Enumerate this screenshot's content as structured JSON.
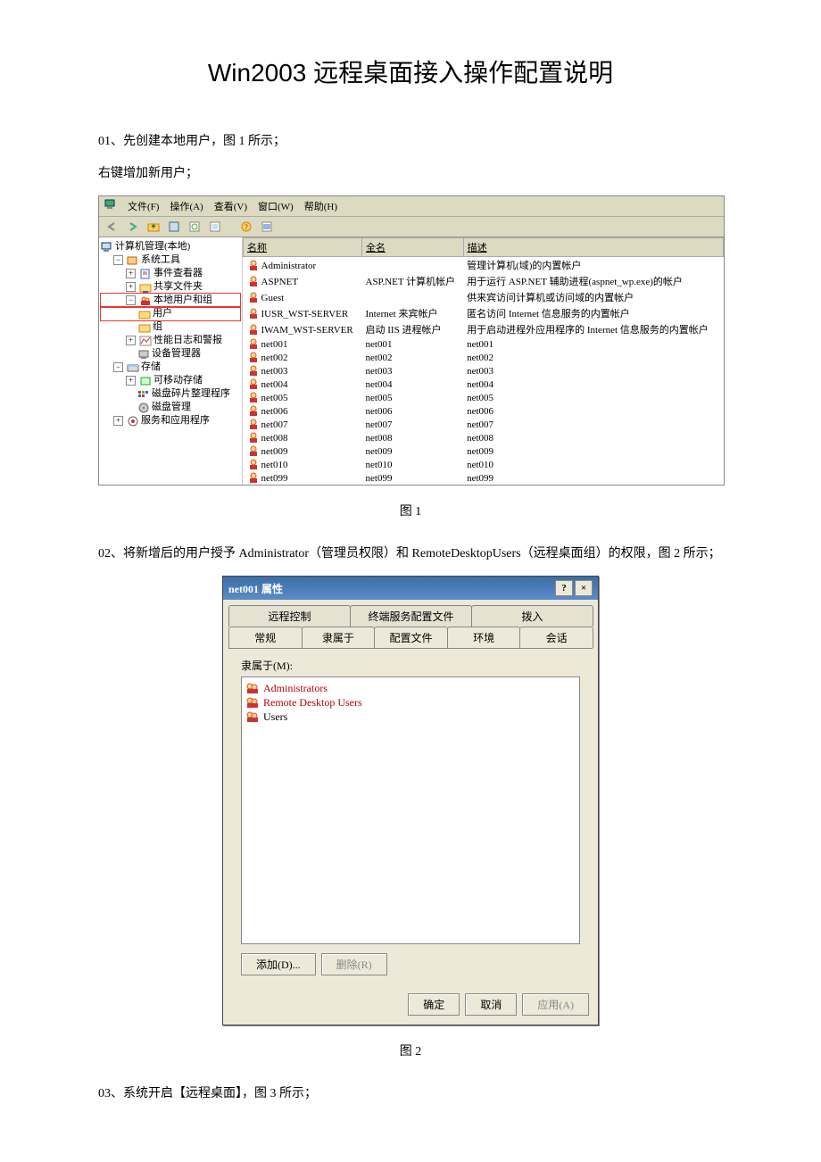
{
  "doc": {
    "title": "Win2003 远程桌面接入操作配置说明",
    "p01": "01、先创建本地用户，图 1 所示；",
    "p01a": "右键增加新用户；",
    "cap1": "图 1",
    "p02": "02、将新增后的用户授予 Administrator（管理员权限）和 RemoteDesktopUsers（远程桌面组）的权限，图 2 所示；",
    "cap2": "图 2",
    "p03": "03、系统开启【远程桌面】，图 3 所示；"
  },
  "mmc": {
    "menu": {
      "file": "文件(F)",
      "action": "操作(A)",
      "view": "查看(V)",
      "window": "窗口(W)",
      "help": "帮助(H)"
    },
    "tree": {
      "root": "计算机管理(本地)",
      "n1": "系统工具",
      "n1a": "事件查看器",
      "n1b": "共享文件夹",
      "n1c": "本地用户和组",
      "n1c1": "用户",
      "n1c2": "组",
      "n1d": "性能日志和警报",
      "n1e": "设备管理器",
      "n2": "存储",
      "n2a": "可移动存储",
      "n2b": "磁盘碎片整理程序",
      "n2c": "磁盘管理",
      "n3": "服务和应用程序"
    },
    "columns": {
      "name": "名称",
      "fullname": "全名",
      "desc": "描述"
    },
    "rows": [
      {
        "name": "Administrator",
        "full": "",
        "desc": "管理计算机(域)的内置帐户"
      },
      {
        "name": "ASPNET",
        "full": "ASP.NET 计算机帐户",
        "desc": "用于运行 ASP.NET 辅助进程(aspnet_wp.exe)的帐户"
      },
      {
        "name": "Guest",
        "full": "",
        "desc": "供来宾访问计算机或访问域的内置帐户"
      },
      {
        "name": "IUSR_WST-SERVER",
        "full": "Internet 来宾帐户",
        "desc": "匿名访问 Internet 信息服务的内置帐户"
      },
      {
        "name": "IWAM_WST-SERVER",
        "full": "启动 IIS 进程帐户",
        "desc": "用于启动进程外应用程序的 Internet 信息服务的内置帐户"
      },
      {
        "name": "net001",
        "full": "net001",
        "desc": "net001"
      },
      {
        "name": "net002",
        "full": "net002",
        "desc": "net002"
      },
      {
        "name": "net003",
        "full": "net003",
        "desc": "net003"
      },
      {
        "name": "net004",
        "full": "net004",
        "desc": "net004"
      },
      {
        "name": "net005",
        "full": "net005",
        "desc": "net005"
      },
      {
        "name": "net006",
        "full": "net006",
        "desc": "net006"
      },
      {
        "name": "net007",
        "full": "net007",
        "desc": "net007"
      },
      {
        "name": "net008",
        "full": "net008",
        "desc": "net008"
      },
      {
        "name": "net009",
        "full": "net009",
        "desc": "net009"
      },
      {
        "name": "net010",
        "full": "net010",
        "desc": "net010"
      },
      {
        "name": "net099",
        "full": "net099",
        "desc": "net099"
      }
    ]
  },
  "dlg": {
    "title": "net001 属性",
    "tabs_back": {
      "remote": "远程控制",
      "ts": "终端服务配置文件",
      "dialin": "拨入"
    },
    "tabs_front": {
      "general": "常规",
      "member": "隶属于",
      "profile": "配置文件",
      "env": "环境",
      "session": "会话"
    },
    "label": "隶属于(M):",
    "groups": [
      {
        "name": "Administrators",
        "hl": true
      },
      {
        "name": "Remote Desktop Users",
        "hl": true
      },
      {
        "name": "Users",
        "hl": false
      }
    ],
    "btn_add": "添加(D)...",
    "btn_remove": "删除(R)",
    "btn_ok": "确定",
    "btn_cancel": "取消",
    "btn_apply": "应用(A)"
  }
}
